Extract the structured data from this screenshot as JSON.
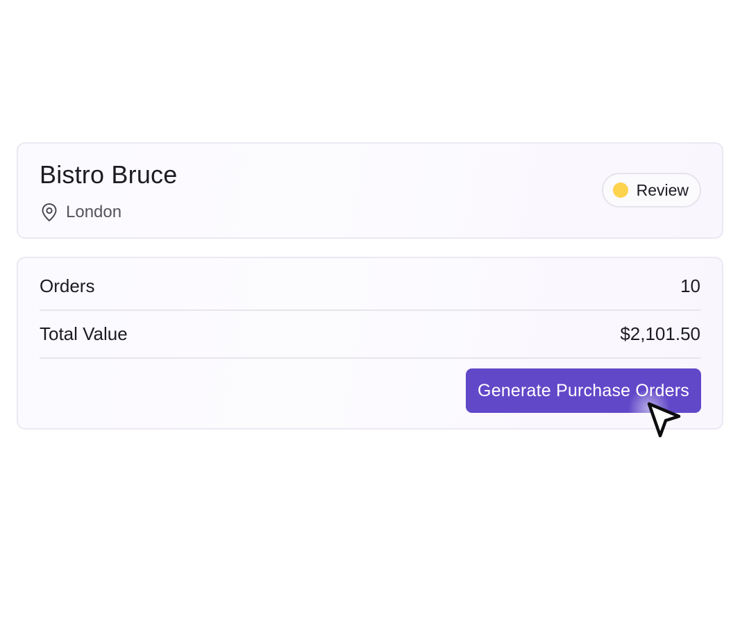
{
  "venue": {
    "name": "Bistro Bruce",
    "location": "London",
    "location_icon": "location-pin-icon"
  },
  "status": {
    "label": "Review",
    "dot_color": "#fdd34e"
  },
  "summary": {
    "rows": [
      {
        "label": "Orders",
        "value": "10"
      },
      {
        "label": "Total Value",
        "value": "$2,101.50"
      }
    ]
  },
  "actions": {
    "generate_label": "Generate Purchase Orders",
    "button_color": "#6148c8"
  },
  "cursor": {
    "icon": "mouse-pointer-icon"
  }
}
